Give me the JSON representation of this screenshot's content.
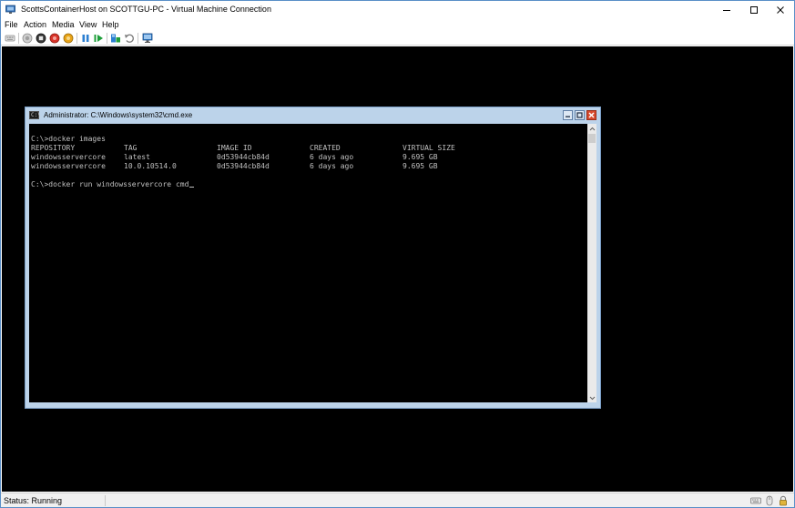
{
  "window": {
    "title": "ScottsContainerHost on SCOTTGU-PC - Virtual Machine Connection"
  },
  "menu": {
    "items": [
      "File",
      "Action",
      "Media",
      "View",
      "Help"
    ]
  },
  "toolbar": {
    "icons": [
      "ctrl-alt-del-icon",
      "start-icon",
      "turn-off-icon",
      "shut-down-icon",
      "save-icon",
      "pause-icon",
      "resume-icon",
      "checkpoint-icon",
      "revert-icon",
      "enhanced-session-icon"
    ]
  },
  "cmd": {
    "title": "Administrator: C:\\Windows\\system32\\cmd.exe",
    "icon_text": "C:\\",
    "lines": {
      "command1": "C:\\>docker images",
      "command2": "C:\\>docker run windowsservercore cmd"
    },
    "table": {
      "headers": [
        "REPOSITORY",
        "TAG",
        "IMAGE ID",
        "CREATED",
        "VIRTUAL SIZE"
      ],
      "rows": [
        [
          "windowsservercore",
          "latest",
          "0d53944cb84d",
          "6 days ago",
          "9.695 GB"
        ],
        [
          "windowsservercore",
          "10.0.10514.0",
          "0d53944cb84d",
          "6 days ago",
          "9.695 GB"
        ]
      ]
    }
  },
  "status": {
    "text": "Status: Running"
  },
  "colors": {
    "accent": "#5a8fc7",
    "console_bg": "#000000",
    "console_fg": "#c0c0c0",
    "close_red": "#d74a2e"
  }
}
